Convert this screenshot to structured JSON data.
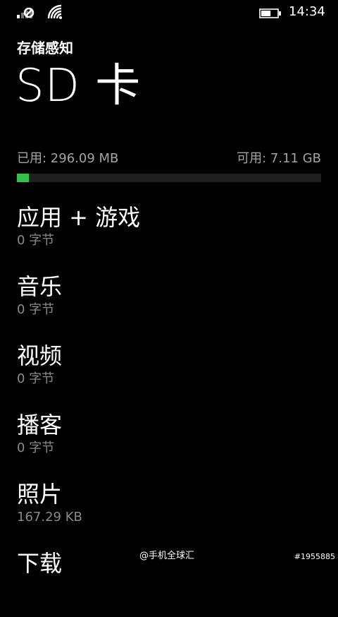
{
  "status_bar": {
    "time": "14:34",
    "signal_icon": "signal-no-sim-icon",
    "wifi_icon": "wifi-icon",
    "battery_icon": "battery-icon",
    "battery_level": 0.6
  },
  "header": {
    "app_title": "存储感知",
    "page_title": "SD 卡"
  },
  "usage": {
    "used_label": "已用: 296.09 MB",
    "free_label": "可用: 7.11 GB",
    "used_fraction": 0.04,
    "bar_fill_color": "#33c24a",
    "bar_track_color": "#1f1f1f"
  },
  "categories": [
    {
      "name": "应用 + 游戏",
      "size": "0 字节"
    },
    {
      "name": "音乐",
      "size": "0 字节"
    },
    {
      "name": "视频",
      "size": "0 字节"
    },
    {
      "name": "播客",
      "size": "0 字节"
    },
    {
      "name": "照片",
      "size": "167.29 KB"
    },
    {
      "name": "下载",
      "size": ""
    }
  ],
  "watermark": {
    "left": "@手机全球汇",
    "right": "#1955885"
  }
}
